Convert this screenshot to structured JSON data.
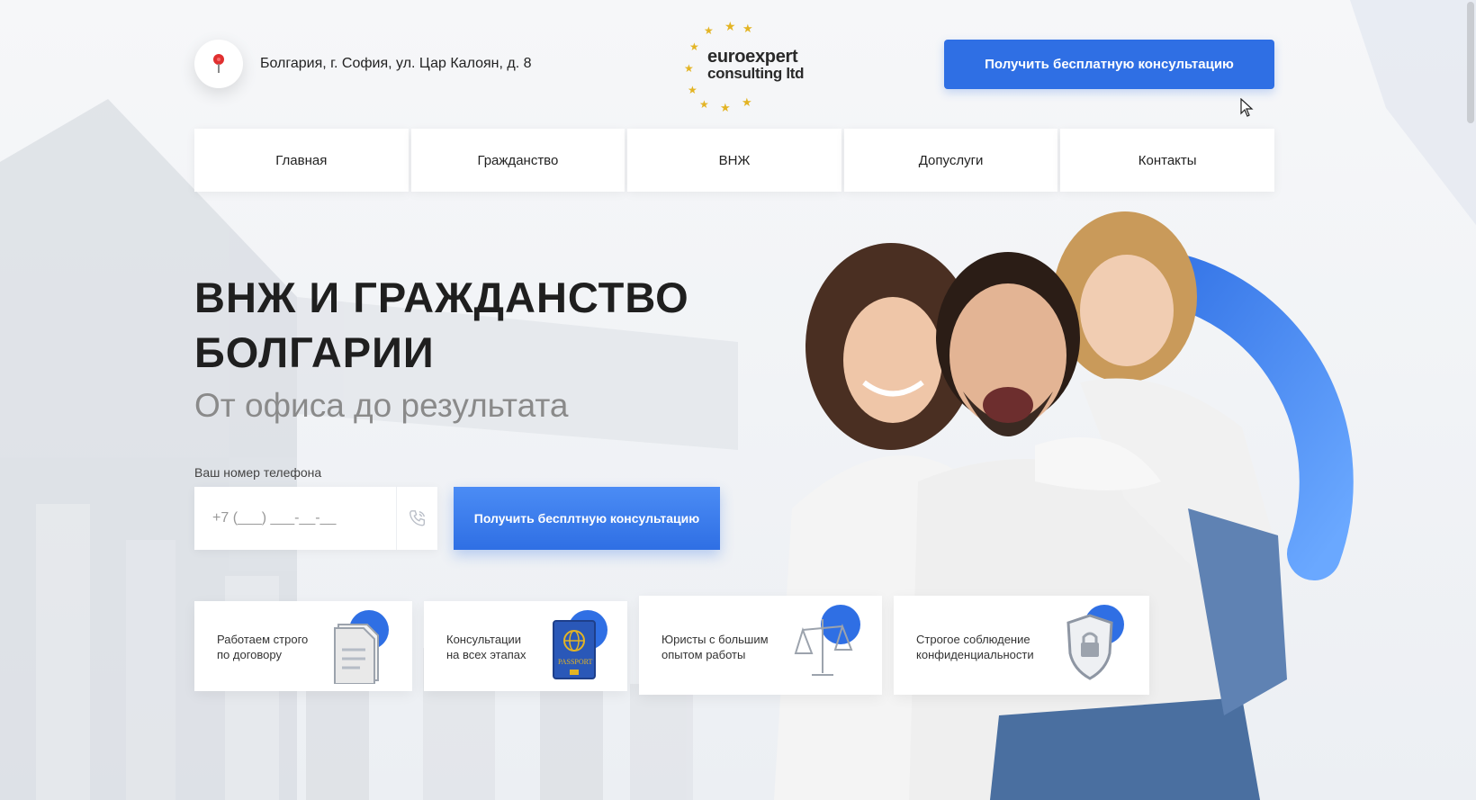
{
  "header": {
    "address": "Болгария, г. София, ул. Цар Калоян, д. 8",
    "logo": {
      "line1": "euroexpert",
      "line2": "consulting ltd"
    },
    "cta_label": "Получить бесплатную консультацию"
  },
  "nav": {
    "items": [
      {
        "label": "Главная"
      },
      {
        "label": "Гражданство"
      },
      {
        "label": "ВНЖ"
      },
      {
        "label": "Допуслуги"
      },
      {
        "label": "Контакты"
      }
    ]
  },
  "hero": {
    "title_line1": "ВНЖ И ГРАЖДАНСТВО",
    "title_line2": "БОЛГАРИИ",
    "subtitle": "От офиса до результата"
  },
  "form": {
    "phone_label": "Ваш номер телефона",
    "phone_placeholder": "+7 (___) ___-__-__",
    "submit_label": "Получить бесплтную консультацию"
  },
  "features": [
    {
      "line1": "Работаем строго",
      "line2": "по договору",
      "icon": "document-icon"
    },
    {
      "line1": "Консультации",
      "line2": "на всех этапах",
      "icon": "passport-icon"
    },
    {
      "line1": "Юристы с большим",
      "line2": "опытом работы",
      "icon": "scales-icon"
    },
    {
      "line1": "Строгое соблюдение",
      "line2": "конфиденциальности",
      "icon": "shield-lock-icon"
    }
  ],
  "colors": {
    "accent": "#2f6fe4",
    "logo_star": "#e3b424"
  }
}
